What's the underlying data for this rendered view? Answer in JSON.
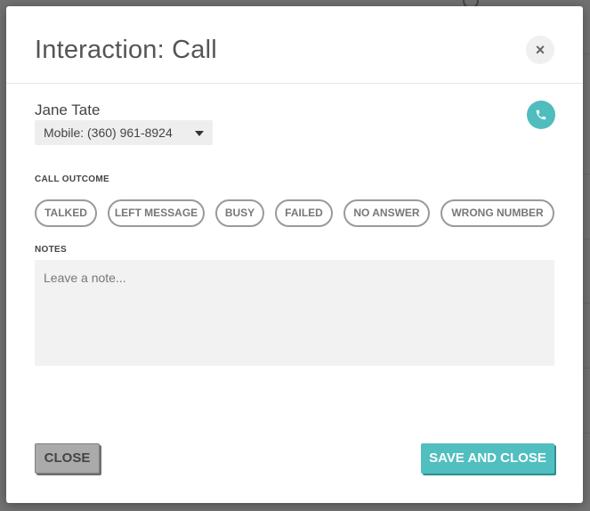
{
  "modal": {
    "title": "Interaction: Call",
    "close_symbol": "×",
    "contact": {
      "name": "Jane Tate",
      "phone_selected": "Mobile: (360) 961-8924"
    },
    "call_outcome": {
      "label": "CALL OUTCOME",
      "options": [
        "TALKED",
        "LEFT MESSAGE",
        "BUSY",
        "FAILED",
        "NO ANSWER",
        "WRONG NUMBER"
      ]
    },
    "notes": {
      "label": "NOTES",
      "placeholder": "Leave a note..."
    },
    "footer": {
      "close_label": "CLOSE",
      "save_label": "SAVE AND CLOSE"
    }
  },
  "icons": {
    "call": "phone-icon",
    "close": "close-icon",
    "dropdown": "caret-down-icon"
  },
  "colors": {
    "accent": "#51bfc0",
    "overlay": "#5a5a5a",
    "text": "#555555"
  }
}
